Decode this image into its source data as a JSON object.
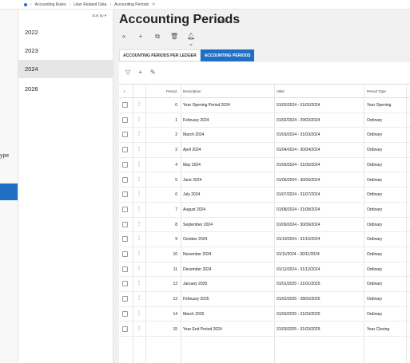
{
  "breadcrumb": [
    "Accounting Rules",
    "User Related Data",
    "Accounting Periods"
  ],
  "refresh_icon": "refresh-icon",
  "left_sliver": {
    "text": "ype"
  },
  "year_list": {
    "sort_label": "Sort by",
    "items": [
      {
        "label": "2022",
        "active": false
      },
      {
        "label": "2023",
        "active": false
      },
      {
        "label": "2024",
        "active": true
      },
      {
        "label": "2026",
        "active": false
      }
    ]
  },
  "page": {
    "title": "Accounting Periods",
    "year": "2024"
  },
  "toolbar": [
    "collapse-icon",
    "add-icon",
    "copy-icon",
    "delete-icon",
    "notify-icon"
  ],
  "tabs": [
    {
      "label": "ACCOUNTING PERIODS PER LEDGER",
      "active": false
    },
    {
      "label": "ACCOUNTING PERIODS",
      "active": true
    }
  ],
  "grid": {
    "columns": {
      "period": "Period",
      "description": "Description",
      "valid": "Valid",
      "period_type": "Period Type"
    },
    "rows": [
      {
        "period": "0",
        "description": "Year Opening Period 2024",
        "valid": "01/02/2024 - 01/02/2024",
        "type": "Year Opening"
      },
      {
        "period": "1",
        "description": "February 2024",
        "valid": "01/02/2024 - 29/02/2024",
        "type": "Ordinary"
      },
      {
        "period": "2",
        "description": "March 2024",
        "valid": "01/03/2024 - 31/03/2024",
        "type": "Ordinary"
      },
      {
        "period": "3",
        "description": "April 2024",
        "valid": "01/04/2024 - 30/04/2024",
        "type": "Ordinary"
      },
      {
        "period": "4",
        "description": "May 2024",
        "valid": "01/05/2024 - 31/05/2024",
        "type": "Ordinary"
      },
      {
        "period": "5",
        "description": "June 2024",
        "valid": "01/06/2024 - 30/06/2024",
        "type": "Ordinary"
      },
      {
        "period": "6",
        "description": "July 2024",
        "valid": "01/07/2024 - 31/07/2024",
        "type": "Ordinary"
      },
      {
        "period": "7",
        "description": "August 2024",
        "valid": "01/08/2024 - 31/08/2024",
        "type": "Ordinary"
      },
      {
        "period": "8",
        "description": "September 2024",
        "valid": "01/09/2024 - 30/09/2024",
        "type": "Ordinary"
      },
      {
        "period": "9",
        "description": "October 2024",
        "valid": "01/10/2024 - 31/10/2024",
        "type": "Ordinary"
      },
      {
        "period": "10",
        "description": "November 2024",
        "valid": "01/11/2024 - 30/11/2024",
        "type": "Ordinary"
      },
      {
        "period": "11",
        "description": "December 2024",
        "valid": "01/12/2024 - 31/12/2024",
        "type": "Ordinary"
      },
      {
        "period": "12",
        "description": "January 2025",
        "valid": "01/01/2025 - 31/01/2025",
        "type": "Ordinary"
      },
      {
        "period": "13",
        "description": "February 2025",
        "valid": "01/02/2025 - 28/02/2025",
        "type": "Ordinary"
      },
      {
        "period": "14",
        "description": "March 2025",
        "valid": "01/03/2025 - 31/03/2025",
        "type": "Ordinary"
      },
      {
        "period": "15",
        "description": "Year End Period 2024",
        "valid": "31/03/2025 - 31/03/2025",
        "type": "Year Closing"
      }
    ]
  }
}
